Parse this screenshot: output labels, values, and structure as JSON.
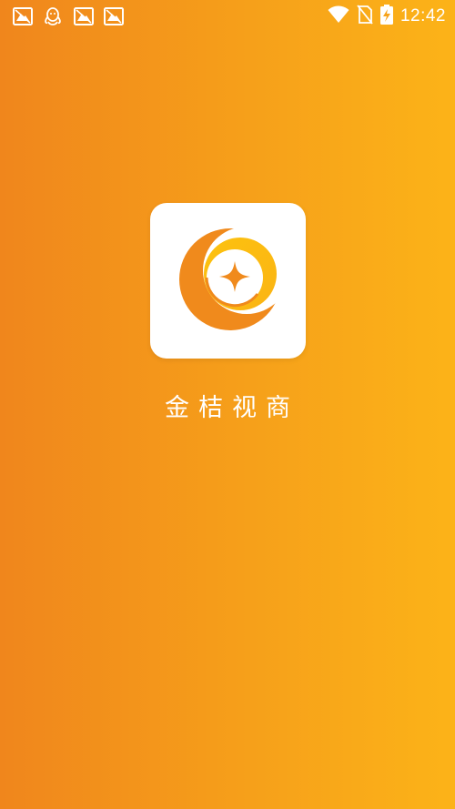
{
  "status_bar": {
    "time": "12:42",
    "notification_icons": [
      "photo-icon",
      "qq-icon",
      "photo-icon",
      "photo-icon"
    ],
    "system_icons": [
      "wifi-icon",
      "no-sim-icon",
      "battery-charging-icon"
    ]
  },
  "splash": {
    "app_name": "金桔视商",
    "logo": "jinju-logo-icon"
  },
  "colors": {
    "gradient_start": "#f0861c",
    "gradient_end": "#fcb318",
    "logo_orange": "#f08a1c",
    "logo_yellow": "#fcc20f"
  }
}
